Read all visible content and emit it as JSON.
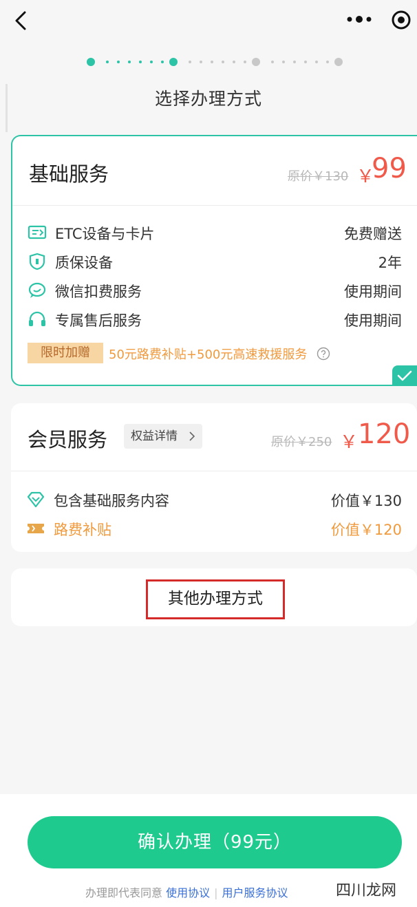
{
  "page": {
    "title": "选择办理方式"
  },
  "steps": {
    "total": 4,
    "active": 2
  },
  "basic_service": {
    "title": "基础服务",
    "original_price": "原价￥130",
    "currency": "￥",
    "price": "99",
    "features": [
      {
        "icon": "etc-card-icon",
        "label": "ETC设备与卡片",
        "value": "免费赠送"
      },
      {
        "icon": "shield-icon",
        "label": "质保设备",
        "value": "2年"
      },
      {
        "icon": "chat-bubble-icon",
        "label": "微信扣费服务",
        "value": "使用期间"
      },
      {
        "icon": "headset-icon",
        "label": "专属售后服务",
        "value": "使用期间"
      }
    ],
    "promo_badge": "限时加赠",
    "promo_text": "50元路费补贴+500元高速救援服务",
    "selected": true
  },
  "member_service": {
    "title": "会员服务",
    "rights_link": "权益详情",
    "original_price": "原价￥250",
    "currency": "￥",
    "price": "120",
    "features": [
      {
        "icon": "diamond-icon",
        "label": "包含基础服务内容",
        "value": "价值￥130"
      },
      {
        "icon": "ticket-icon",
        "label": "路费补贴",
        "value": "价值￥120"
      }
    ]
  },
  "other_methods": {
    "label": "其他办理方式"
  },
  "footer": {
    "confirm_label": "确认办理（99元）",
    "agree_prefix": "办理即代表同意",
    "link_usage": "使用协议",
    "link_user_service": "用户服务协议",
    "watermark": "四川龙网"
  },
  "colors": {
    "accent_green": "#1fca8f",
    "teal": "#2cc3a6",
    "price_red": "#f05a4a",
    "promo_orange": "#f09a3e",
    "highlight_red": "#d42a2a"
  }
}
